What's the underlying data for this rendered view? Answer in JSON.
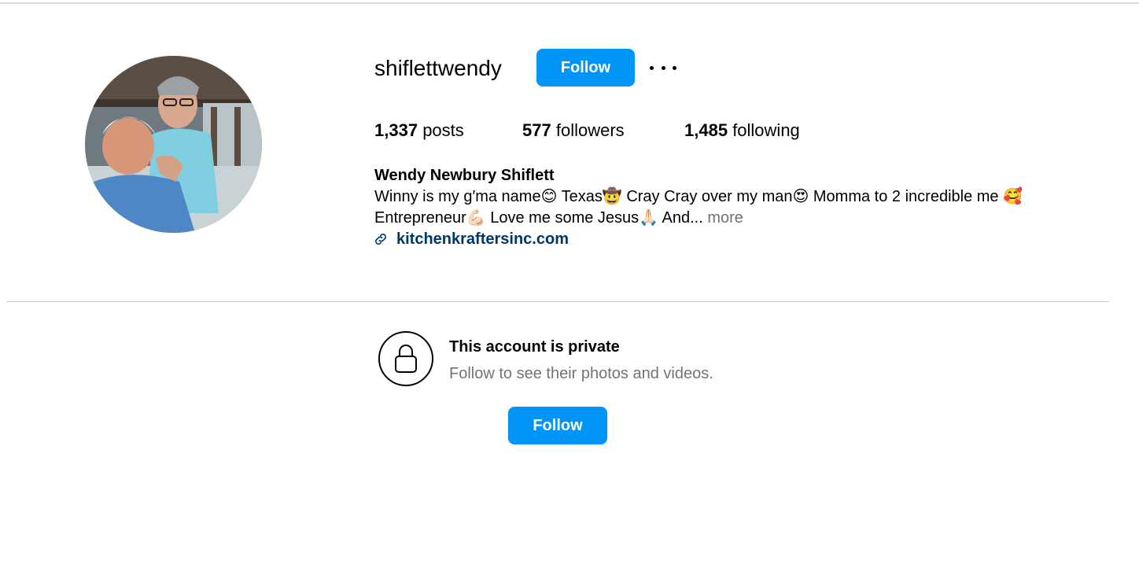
{
  "profile": {
    "username": "shiflettwendy",
    "follow_label": "Follow",
    "more_options_icon": "more-horizontal-icon",
    "stats": {
      "posts_count": "1,337",
      "posts_label": "posts",
      "followers_count": "577",
      "followers_label": "followers",
      "following_count": "1,485",
      "following_label": "following"
    },
    "full_name": "Wendy Newbury Shiflett",
    "bio_line_1": "Winny is my g′ma name😊 Texas🤠 Cray Cray over my man😍 Momma to 2 incredible me 🥰",
    "bio_line_2": "Entrepreneur💪🏻 Love me some Jesus🙏🏻 And... ",
    "more_label": "more",
    "website": "kitchenkraftersinc.com",
    "link_icon": "link-icon"
  },
  "private_notice": {
    "lock_icon": "lock-icon",
    "title": "This account is private",
    "subtitle": "Follow to see their photos and videos.",
    "follow_label": "Follow"
  },
  "colors": {
    "primary_button": "#0095f6",
    "link": "#00376b",
    "muted_text": "#737373"
  }
}
